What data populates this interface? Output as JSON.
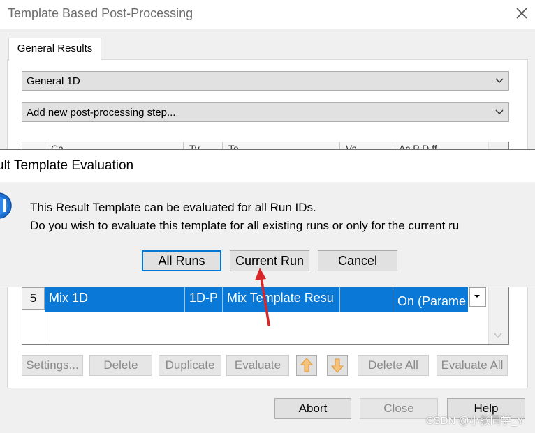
{
  "window": {
    "title": "Template Based Post-Processing",
    "tab": "General Results"
  },
  "combos": {
    "category_value": "General 1D",
    "add_step_value": "Add new post-processing step..."
  },
  "grid": {
    "header_cells": [
      "Ca",
      "Ty",
      "Te",
      "Va",
      "Ac   P   D ff"
    ],
    "selected_row": {
      "number": "5",
      "cells": [
        "Mix 1D",
        "1D-P",
        "Mix Template Resu",
        "",
        "On (Parame"
      ]
    }
  },
  "buttons": {
    "settings": "Settings...",
    "delete": "Delete",
    "duplicate": "Duplicate",
    "evaluate": "Evaluate",
    "delete_all": "Delete All",
    "evaluate_all": "Evaluate All",
    "abort": "Abort",
    "close": "Close",
    "help": "Help"
  },
  "dialog": {
    "title": "ult Template Evaluation",
    "message_line1": "This Result Template can be evaluated for all Run IDs.",
    "message_line2": "Do you wish to evaluate this template for all existing runs or only for the current ru",
    "buttons": [
      "All Runs",
      "Current Run",
      "Cancel"
    ]
  },
  "watermark": "CSDN @小张同学_Y",
  "colors": {
    "selection": "#0a78d7",
    "default_button_border": "#0078d7",
    "annotation_arrow": "#d9262a",
    "move_arrow": "#f5b041"
  },
  "icons": [
    "close-icon",
    "chevron-down-icon",
    "info-icon",
    "arrow-up-icon",
    "arrow-down-icon"
  ]
}
